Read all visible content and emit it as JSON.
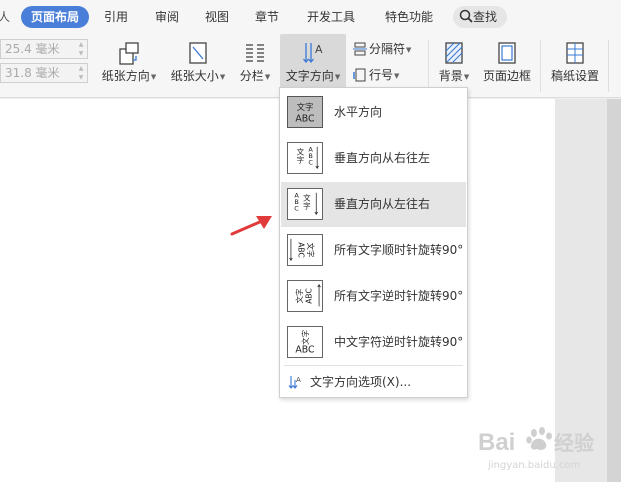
{
  "tabs": [
    {
      "label": "页面布局",
      "active": true
    },
    {
      "label": "引用"
    },
    {
      "label": "审阅"
    },
    {
      "label": "视图"
    },
    {
      "label": "章节"
    },
    {
      "label": "开发工具"
    },
    {
      "label": "特色功能"
    }
  ],
  "tab_fragment": "人",
  "search": {
    "label": "查找"
  },
  "margins": {
    "top_value": "25.4 毫米",
    "bottom_value": "31.8 毫米"
  },
  "ribbon": {
    "orientation": "纸张方向",
    "size": "纸张大小",
    "columns": "分栏",
    "text_direction": "文字方向",
    "separator": "分隔符",
    "line_number": "行号",
    "background": "背景",
    "page_border": "页面边框",
    "draft_paper": "稿纸设置"
  },
  "menu": {
    "items": [
      {
        "label": "水平方向",
        "selected": true
      },
      {
        "label": "垂直方向从右往左"
      },
      {
        "label": "垂直方向从左往右",
        "hovered": true
      },
      {
        "label": "所有文字顺时针旋转90°"
      },
      {
        "label": "所有文字逆时针旋转90°"
      },
      {
        "label": "中文字符逆时针旋转90°"
      }
    ],
    "options_label": "文字方向选项(X)..."
  },
  "thumb_text": {
    "zh": "文字",
    "en": "ABC",
    "zh_vert_1": "文",
    "zh_vert_2": "字",
    "en_vert_1": "A",
    "en_vert_2": "B",
    "en_vert_3": "C"
  },
  "watermark": {
    "brand": "Bai",
    "brand_cn": "经验",
    "url": "jingyan.baidu.com"
  },
  "colors": {
    "accent": "#4a7fd9",
    "arrow": "#e03a3a"
  }
}
